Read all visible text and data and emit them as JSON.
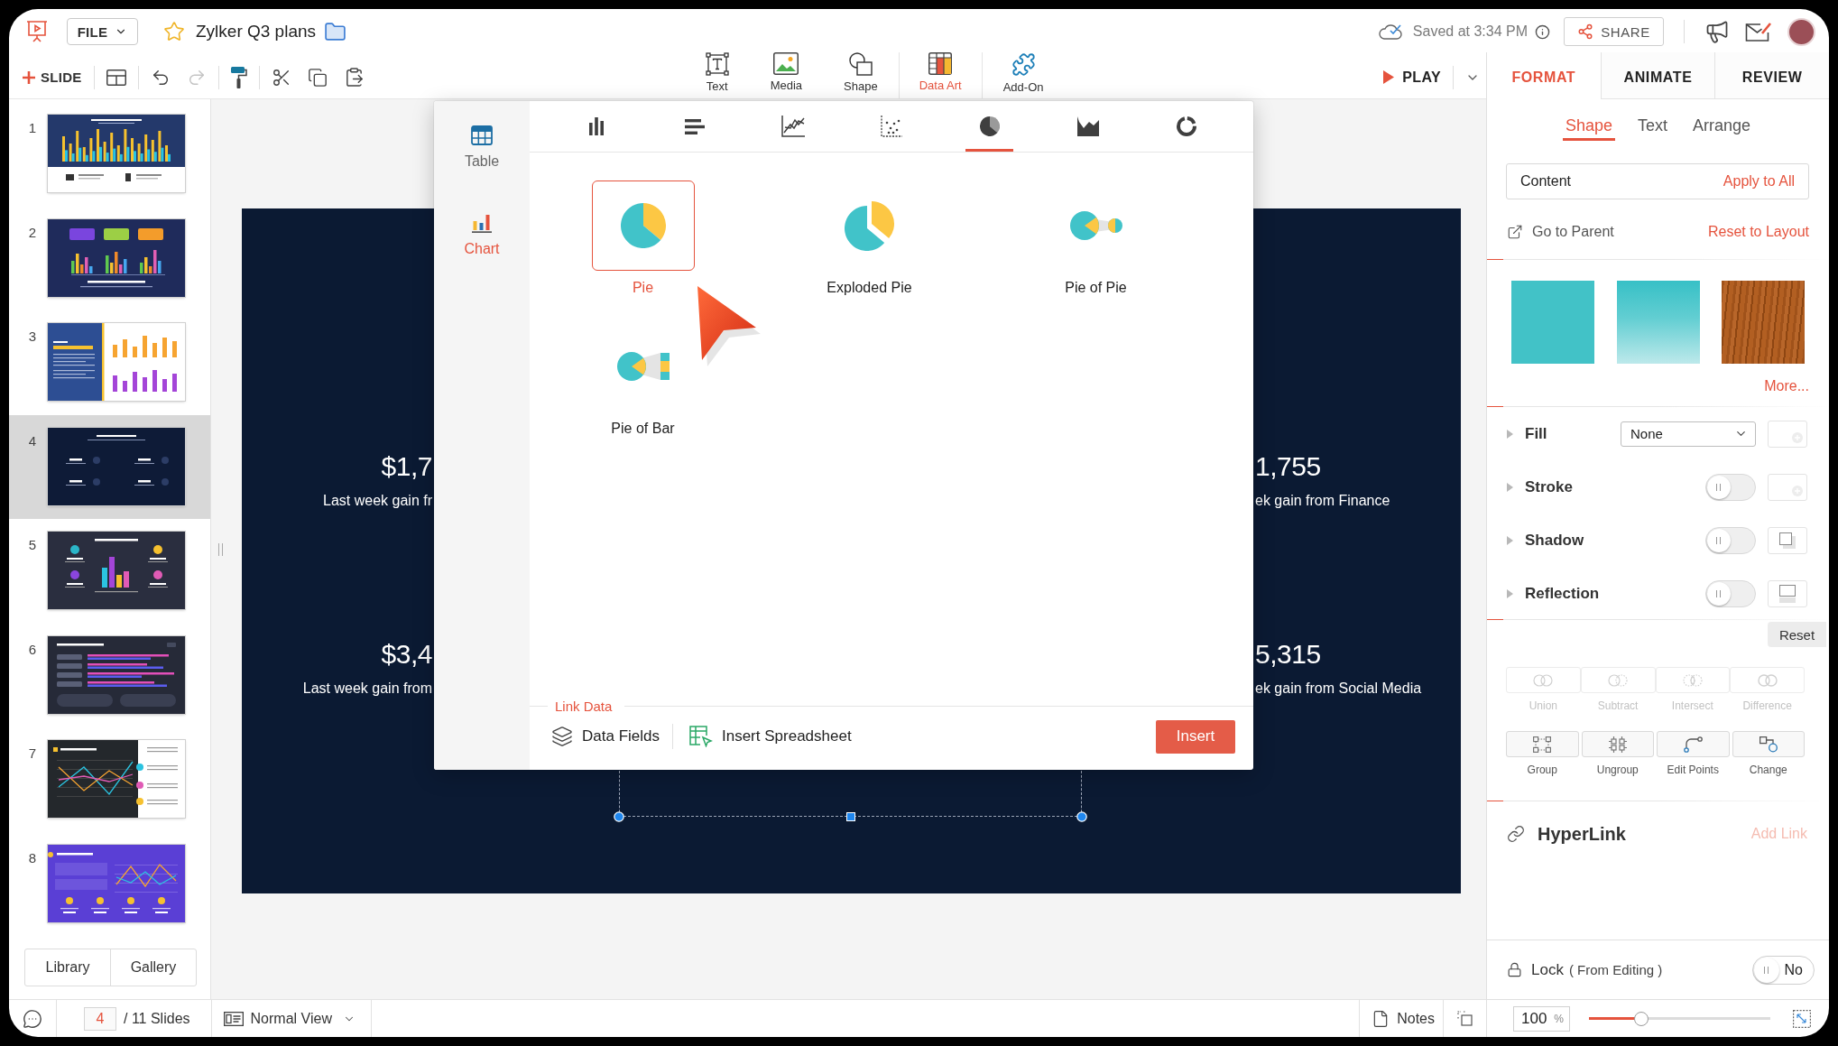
{
  "app_bar": {
    "file_menu": "FILE",
    "title": "Zylker Q3 plans",
    "save_status": "Saved at 3:34 PM",
    "share": "SHARE"
  },
  "toolbar": {
    "new_slide": "SLIDE",
    "edit_groups": [
      [
        {
          "kind": "layout",
          "disabled": false
        }
      ],
      [
        {
          "kind": "undo",
          "disabled": false
        },
        {
          "kind": "redo",
          "disabled": true
        }
      ],
      [
        {
          "kind": "format-painter",
          "disabled": false
        }
      ],
      [
        {
          "kind": "cut",
          "disabled": false
        },
        {
          "kind": "copy",
          "disabled": false
        },
        {
          "kind": "paste",
          "disabled": false
        }
      ]
    ],
    "insert_tools": [
      {
        "label": "Text",
        "kind": "text",
        "selected": false
      },
      {
        "label": "Media",
        "kind": "media",
        "selected": false
      },
      {
        "label": "Shape",
        "kind": "shape",
        "selected": false
      },
      {
        "label": "Data Art",
        "kind": "data-art",
        "selected": true
      },
      {
        "label": "Add-On",
        "kind": "add-on",
        "selected": false
      }
    ],
    "play": "PLAY"
  },
  "slides": [
    {
      "number": "1",
      "kind": "column-chart",
      "selected": false
    },
    {
      "number": "2",
      "kind": "callout-bars",
      "selected": false
    },
    {
      "number": "3",
      "kind": "report-split",
      "selected": false
    },
    {
      "number": "4",
      "kind": "stats-dark",
      "selected": true
    },
    {
      "number": "5",
      "kind": "icon-bars",
      "selected": false
    },
    {
      "number": "6",
      "kind": "horizontal-bars",
      "selected": false
    },
    {
      "number": "7",
      "kind": "line-split",
      "selected": false
    },
    {
      "number": "8",
      "kind": "purple-lines",
      "selected": false
    }
  ],
  "library_tabs": [
    "Library",
    "Gallery"
  ],
  "slide_canvas": {
    "left_stats": [
      {
        "value": "$1,7",
        "caption": "Last week gain fr"
      },
      {
        "value": "$3,4",
        "caption": "Last week gain from"
      }
    ],
    "right_stats": [
      {
        "value": "1,755",
        "caption": "ek gain from Finance"
      },
      {
        "value": "5,315",
        "caption": "ek gain from Social Media"
      }
    ]
  },
  "insert_dialog": {
    "categories": [
      {
        "label": "Table",
        "kind": "table",
        "selected": false
      },
      {
        "label": "Chart",
        "kind": "chart",
        "selected": true
      }
    ],
    "chart_types": [
      {
        "kind": "column",
        "selected": false
      },
      {
        "kind": "bar",
        "selected": false
      },
      {
        "kind": "line",
        "selected": false
      },
      {
        "kind": "scatter",
        "selected": false
      },
      {
        "kind": "pie",
        "selected": true
      },
      {
        "kind": "area",
        "selected": false
      },
      {
        "kind": "donut",
        "selected": false
      }
    ],
    "charts": [
      {
        "label": "Pie",
        "kind": "pie",
        "selected": true
      },
      {
        "label": "Exploded Pie",
        "kind": "exploded-pie",
        "selected": false
      },
      {
        "label": "Pie of Pie",
        "kind": "pie-of-pie",
        "selected": false
      },
      {
        "label": "Pie of Bar",
        "kind": "pie-of-bar",
        "selected": false
      }
    ],
    "link_data": {
      "title": "Link Data",
      "data_fields": "Data Fields",
      "insert_spreadsheet": "Insert Spreadsheet"
    },
    "insert": "Insert"
  },
  "status_bar": {
    "current_slide": "4",
    "slide_count": "/ 11 Slides",
    "view": "Normal View",
    "notes": "Notes"
  },
  "format_panel": {
    "tabs": [
      {
        "label": "FORMAT",
        "selected": true
      },
      {
        "label": "ANIMATE",
        "selected": false
      },
      {
        "label": "REVIEW",
        "selected": false
      }
    ],
    "subtabs": [
      {
        "label": "Shape",
        "selected": true
      },
      {
        "label": "Text",
        "selected": false
      },
      {
        "label": "Arrange",
        "selected": false
      }
    ],
    "content": {
      "label": "Content",
      "action": "Apply to All"
    },
    "go_to_parent": "Go to Parent",
    "reset_to_layout": "Reset to Layout",
    "fill_presets": [
      {
        "kind": "solid"
      },
      {
        "kind": "gradient"
      },
      {
        "kind": "wood"
      }
    ],
    "more": "More...",
    "properties": [
      {
        "label": "Fill",
        "kind": "select",
        "value": "None",
        "preview": {
          "kind": "color"
        }
      },
      {
        "label": "Stroke",
        "kind": "toggle",
        "on": false,
        "preview": {
          "kind": "color"
        }
      },
      {
        "label": "Shadow",
        "kind": "toggle",
        "on": false,
        "preview": {
          "kind": "shadow"
        }
      },
      {
        "label": "Reflection",
        "kind": "toggle",
        "on": false,
        "preview": {
          "kind": "reflection"
        }
      }
    ],
    "reset": "Reset",
    "path_ops": [
      {
        "label": "Union",
        "kind": "union",
        "disabled": true
      },
      {
        "label": "Subtract",
        "kind": "subtract",
        "disabled": true
      },
      {
        "label": "Intersect",
        "kind": "intersect",
        "disabled": true
      },
      {
        "label": "Difference",
        "kind": "difference",
        "disabled": true
      }
    ],
    "shape_ops": [
      {
        "label": "Group",
        "kind": "group",
        "disabled": false
      },
      {
        "label": "Ungroup",
        "kind": "ungroup",
        "disabled": false
      },
      {
        "label": "Edit Points",
        "kind": "edit-points",
        "disabled": false
      },
      {
        "label": "Change",
        "kind": "change",
        "disabled": false
      }
    ],
    "hyperlink": {
      "label": "HyperLink",
      "action": "Add Link",
      "disabled": true
    },
    "lock": {
      "label": "Lock",
      "note": "( From Editing )",
      "toggle": "No",
      "on": false
    },
    "zoom": {
      "value": "100",
      "unit": "%",
      "level": 0.29
    }
  }
}
